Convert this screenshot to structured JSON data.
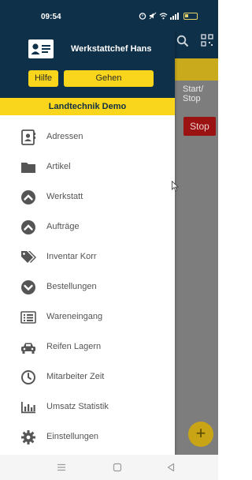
{
  "status_bar": {
    "time": "09:54",
    "battery_level": "25",
    "icons": [
      "alarm-icon",
      "mute-icon",
      "wifi-icon",
      "signal-icon",
      "battery-icon"
    ]
  },
  "background_app": {
    "start_stop_label": "Start/\nStop",
    "stop_button_label": "Stop",
    "fab_label": "+"
  },
  "drawer": {
    "user_name": "Werkstattchef Hans",
    "help_button": "Hilfe",
    "leave_button": "Gehen",
    "company": "Landtechnik Demo",
    "items": [
      {
        "label": "Adressen",
        "icon": "address-book-icon"
      },
      {
        "label": "Artikel",
        "icon": "folder-icon"
      },
      {
        "label": "Werkstatt",
        "icon": "chevron-up-circle-icon"
      },
      {
        "label": "Aufträge",
        "icon": "chevron-up-circle-icon"
      },
      {
        "label": "Inventar Korr",
        "icon": "tags-icon"
      },
      {
        "label": "Bestellungen",
        "icon": "chevron-down-circle-icon"
      },
      {
        "label": "Wareneingang",
        "icon": "list-alt-icon"
      },
      {
        "label": "Reifen Lagern",
        "icon": "car-icon"
      },
      {
        "label": "Mitarbeiter Zeit",
        "icon": "clock-icon"
      },
      {
        "label": "Umsatz Statistik",
        "icon": "bar-chart-icon"
      },
      {
        "label": "Einstellungen",
        "icon": "gear-icon"
      }
    ]
  },
  "colors": {
    "header_bg": "#0e3049",
    "accent_yellow": "#f9d61b",
    "icon_gray": "#555555",
    "stop_red": "#9b1212"
  }
}
